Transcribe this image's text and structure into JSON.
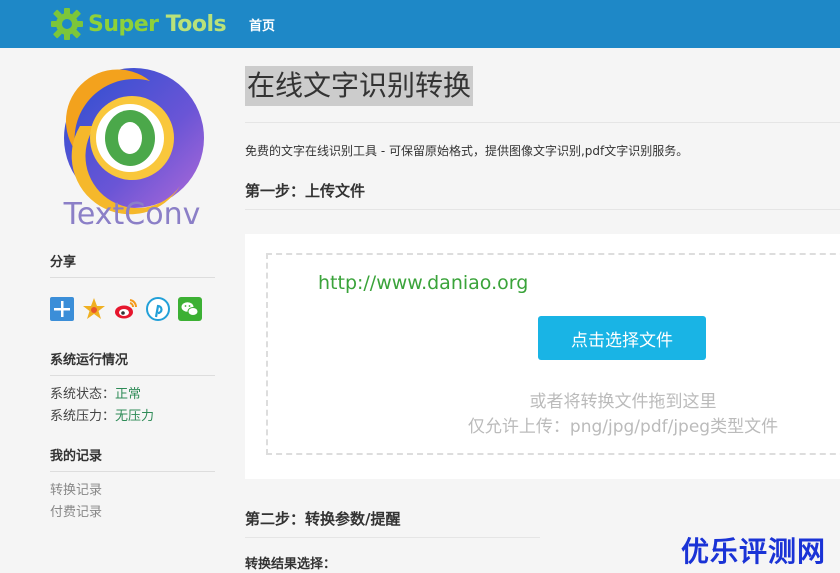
{
  "header": {
    "logo_text_a": "Super",
    "logo_text_b": " Tools",
    "nav_home": "首页"
  },
  "sidebar": {
    "brand_text": "TextConv",
    "share_title": "分享",
    "share_icons": [
      "plus-share-icon",
      "qzone-star-icon",
      "weibo-icon",
      "pinterest-like-icon",
      "wechat-icon"
    ],
    "status_title": "系统运行情况",
    "status_label": "系统状态：",
    "status_value": "正常",
    "load_label": "系统压力：",
    "load_value": "无压力",
    "records_title": "我的记录",
    "records": [
      "转换记录",
      "付费记录"
    ]
  },
  "main": {
    "title": "在线文字识别转换",
    "description": "免费的文字在线识别工具 - 可保留原始格式，提供图像文字识别,pdf文字识别服务。",
    "step1_title": "第一步：上传文件",
    "upload": {
      "url_text": "http://www.daniao.org",
      "button_label": "点击选择文件",
      "hint_line1": "或者将转换文件拖到这里",
      "hint_line2": "仅允许上传：png/jpg/pdf/jpeg类型文件"
    },
    "step2_title": "第二步：转换参数/提醒",
    "result_select_label": "转换结果选择："
  },
  "watermark": "优乐评测网",
  "colors": {
    "header_bg": "#1e88c7",
    "button_bg": "#19b4e5",
    "ok_green": "#2e8b57",
    "watermark_blue": "#1a33d6"
  }
}
